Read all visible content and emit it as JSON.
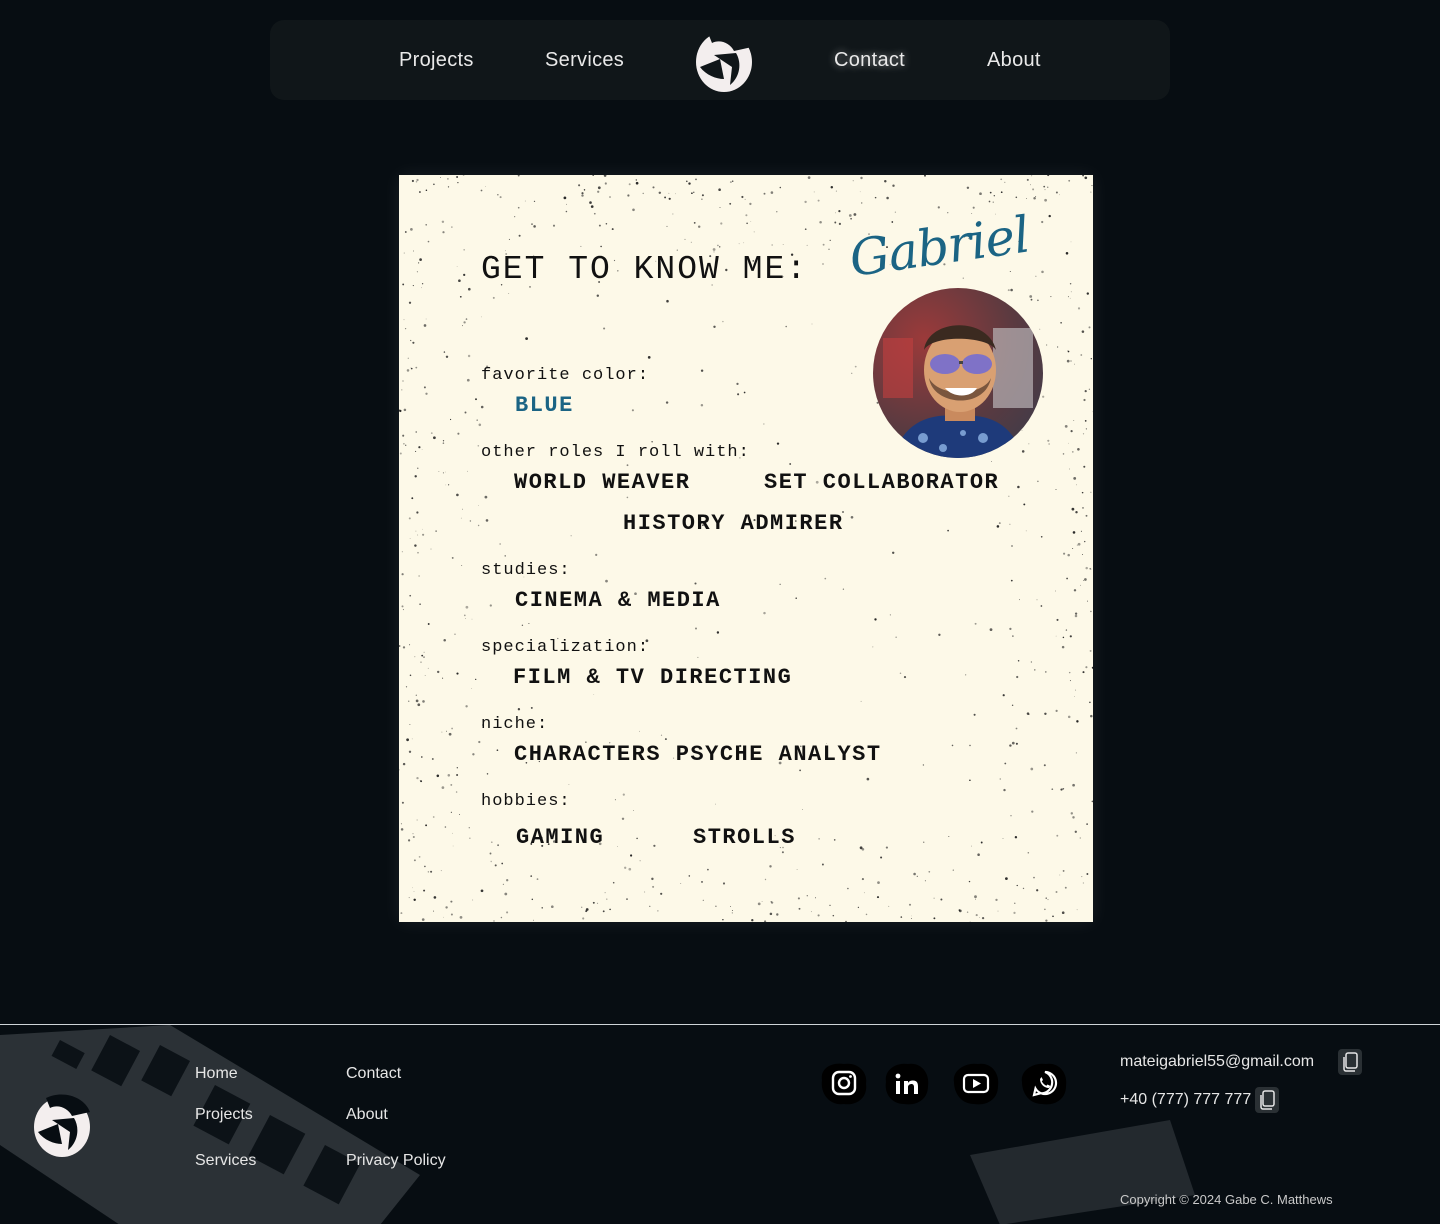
{
  "nav": {
    "projects": "Projects",
    "services": "Services",
    "contact": "Contact",
    "about": "About",
    "logo_icon": "aperture-logo-icon"
  },
  "card": {
    "heading": "GET TO KNOW ME:",
    "signature": "Gabriel",
    "favorite_color_label": "favorite color:",
    "favorite_color": "BLUE",
    "roles_label": "other roles I roll with:",
    "roles": [
      "WORLD WEAVER",
      "SET COLLABORATOR",
      "HISTORY ADMIRER"
    ],
    "studies_label": "studies:",
    "studies": "CINEMA & MEDIA",
    "specialization_label": "specialization:",
    "specialization": "FILM & TV DIRECTING",
    "niche_label": "niche:",
    "niche": "CHARACTERS PSYCHE ANALYST",
    "hobbies_label": "hobbies:",
    "hobbies": [
      "GAMING",
      "STROLLS"
    ],
    "accent_color": "#1b6484"
  },
  "footer": {
    "links": {
      "home": "Home",
      "projects": "Projects",
      "services": "Services",
      "contact": "Contact",
      "about": "About",
      "privacy": "Privacy Policy"
    },
    "socials": [
      "instagram-icon",
      "linkedin-icon",
      "youtube-icon",
      "whatsapp-icon"
    ],
    "email": "mateigabriel55@gmail.com",
    "phone": "+40 (777) 777 777",
    "copyright": "Copyright © 2024 Gabe C. Matthews"
  }
}
